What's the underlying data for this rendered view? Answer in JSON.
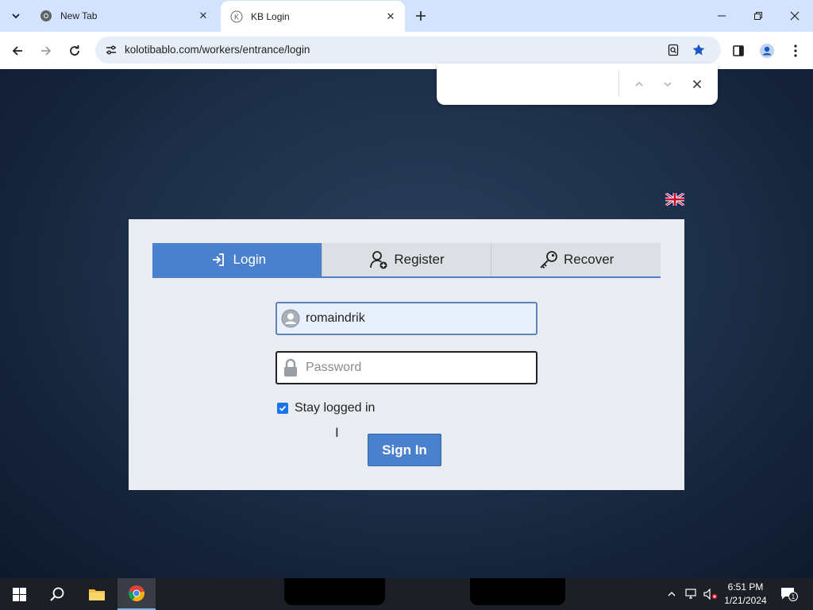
{
  "browser": {
    "tabs": [
      {
        "title": "New Tab",
        "active": false
      },
      {
        "title": "KB Login",
        "active": true,
        "favicon_letter": "K"
      }
    ],
    "address_bar": {
      "url": "kolotibablo.com/workers/entrance/login"
    },
    "find_bar": {
      "query": ""
    }
  },
  "login_panel": {
    "language_flag": "uk-flag-icon",
    "tabs": [
      {
        "label": "Login",
        "icon": "login-arrow-icon",
        "active": true
      },
      {
        "label": "Register",
        "icon": "user-add-icon",
        "active": false
      },
      {
        "label": "Recover",
        "icon": "key-icon",
        "active": false
      }
    ],
    "username": {
      "value": "romaindrik",
      "icon": "user-icon"
    },
    "password": {
      "placeholder": "Password",
      "value": "",
      "icon": "lock-icon"
    },
    "stay_logged_in": {
      "label": "Stay logged in",
      "checked": true
    },
    "sign_in_label": "Sign In"
  },
  "taskbar": {
    "time": "6:51 PM",
    "date": "1/21/2024",
    "notification_count": "1"
  },
  "colors": {
    "accent": "#4a80cc",
    "tabstrip": "#d3e3fd",
    "page_bg": "#1e3049"
  }
}
